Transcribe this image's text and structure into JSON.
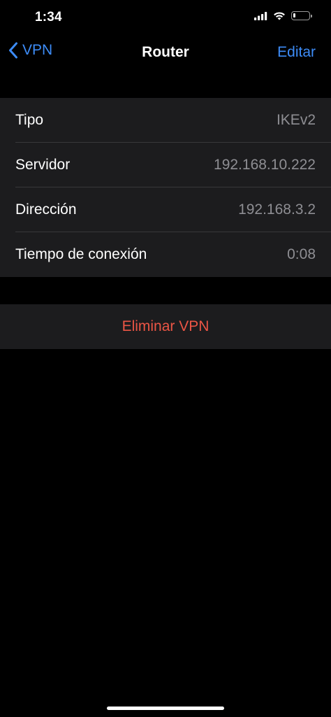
{
  "status_bar": {
    "time": "1:34",
    "icons": [
      "signal-icon",
      "wifi-icon",
      "battery-icon"
    ],
    "battery_level_fraction": 0.15
  },
  "nav": {
    "back_label": "VPN",
    "title": "Router",
    "edit_label": "Editar"
  },
  "info": {
    "rows": [
      {
        "label": "Tipo",
        "value": "IKEv2"
      },
      {
        "label": "Servidor",
        "value": "192.168.10.222"
      },
      {
        "label": "Dirección",
        "value": "192.168.3.2"
      },
      {
        "label": "Tiempo de conexión",
        "value": "0:08"
      }
    ]
  },
  "actions": {
    "delete_label": "Eliminar VPN"
  },
  "colors": {
    "accent": "#3d8cf7",
    "destructive": "#eb5545",
    "background": "#000000",
    "group_background": "#1c1c1e",
    "secondary_text": "#8e8e93"
  }
}
